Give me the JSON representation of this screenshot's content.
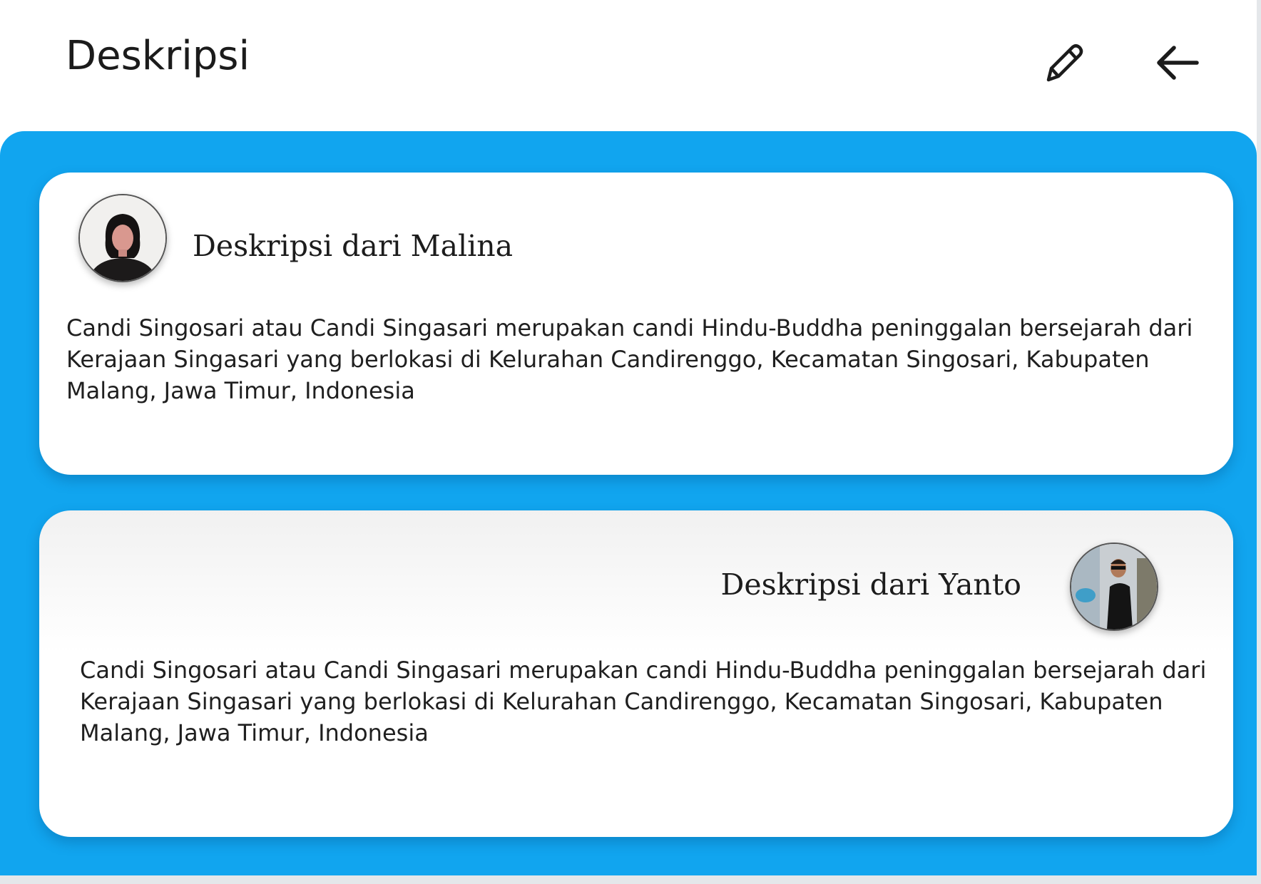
{
  "header": {
    "title": "Deskripsi",
    "edit_icon": "pencil-icon",
    "back_icon": "arrow-left-icon"
  },
  "colors": {
    "accent": "#11a5ef",
    "card": "#ffffff",
    "text": "#1b1b1b"
  },
  "descriptions": [
    {
      "author_label": "Deskripsi dari Malina",
      "avatar": "avatar-malina",
      "text": "Candi Singosari atau Candi Singasari merupakan candi Hindu-Buddha peninggalan bersejarah dari Kerajaan Singasari yang berlokasi di Kelurahan Candirenggo, Kecamatan Singosari, Kabupaten Malang, Jawa Timur, Indonesia"
    },
    {
      "author_label": "Deskripsi dari Yanto",
      "avatar": "avatar-yanto",
      "text": "Candi Singosari atau Candi Singasari merupakan candi Hindu-Buddha peninggalan bersejarah dari Kerajaan Singasari yang berlokasi di Kelurahan Candirenggo, Kecamatan Singosari, Kabupaten Malang, Jawa Timur, Indonesia"
    }
  ]
}
